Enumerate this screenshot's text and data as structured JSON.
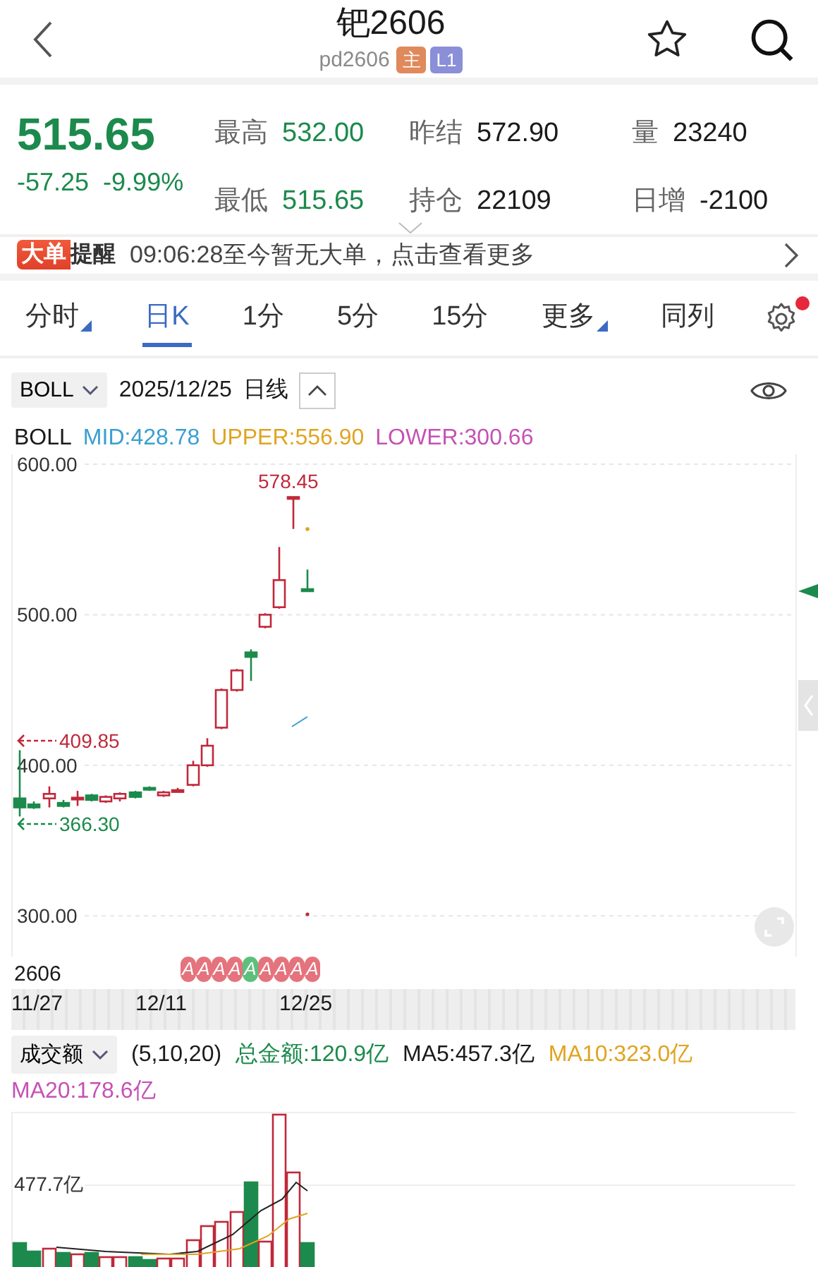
{
  "header": {
    "title": "钯2606",
    "code": "pd2606",
    "tags": [
      {
        "text": "主",
        "color": "#e0895a"
      },
      {
        "text": "L1",
        "color": "#8b8fd8"
      }
    ]
  },
  "quote": {
    "price": "515.65",
    "change": "-57.25",
    "percent": "-9.99%",
    "stats": [
      {
        "label": "最高",
        "value": "532.00",
        "color": "#1c8a4c"
      },
      {
        "label": "昨结",
        "value": "572.90",
        "color": "#1a1a1a"
      },
      {
        "label": "量",
        "value": "23240",
        "color": "#1a1a1a"
      },
      {
        "label": "最低",
        "value": "515.65",
        "color": "#1c8a4c"
      },
      {
        "label": "持仓",
        "value": "22109",
        "color": "#1a1a1a"
      },
      {
        "label": "日增",
        "value": "-2100",
        "color": "#1a1a1a"
      }
    ]
  },
  "alert": {
    "badge_left": "大单",
    "badge_right": "提醒",
    "message": "09:06:28至今暂无大单，点击查看更多"
  },
  "tabs": [
    {
      "label": "分时",
      "selected": false,
      "dropdown": true
    },
    {
      "label": "日K",
      "selected": true,
      "dropdown": false
    },
    {
      "label": "1分",
      "selected": false,
      "dropdown": false
    },
    {
      "label": "5分",
      "selected": false,
      "dropdown": false
    },
    {
      "label": "15分",
      "selected": false,
      "dropdown": false
    },
    {
      "label": "更多",
      "selected": false,
      "dropdown": true
    },
    {
      "label": "同列",
      "selected": false,
      "dropdown": false
    }
  ],
  "settings": {
    "badge": true
  },
  "indicator_bar": {
    "indicator": "BOLL",
    "date": "2025/12/25",
    "period": "日线"
  },
  "boll_legend": [
    {
      "text": "BOLL",
      "color": "#1a1a1a"
    },
    {
      "text": "MID:428.78",
      "color": "#3a9fd0"
    },
    {
      "text": "UPPER:556.90",
      "color": "#e0a422"
    },
    {
      "text": "LOWER:300.66",
      "color": "#c552b4"
    }
  ],
  "price_chart": {
    "y_labels": [
      "600.00",
      "500.00",
      "400.00",
      "300.00"
    ],
    "high_label": "578.45",
    "max_marker": "409.85",
    "min_marker": "366.30"
  },
  "signals": {
    "contract": "2606",
    "bubbles": [
      {
        "text": "A",
        "color": "#e5737d"
      },
      {
        "text": "A",
        "color": "#e5737d"
      },
      {
        "text": "A",
        "color": "#e5737d"
      },
      {
        "text": "A",
        "color": "#e5737d"
      },
      {
        "text": "A",
        "color": "#5cc07a"
      },
      {
        "text": "A",
        "color": "#e5737d"
      },
      {
        "text": "A",
        "color": "#e5737d"
      },
      {
        "text": "A",
        "color": "#e5737d"
      },
      {
        "text": "A",
        "color": "#e5737d"
      }
    ]
  },
  "dates": [
    "11/27",
    "12/11",
    "12/25"
  ],
  "volume": {
    "indicator": "成交额",
    "legend": [
      {
        "text": "(5,10,20)",
        "color": "#1a1a1a"
      },
      {
        "text": "总金额:120.9亿",
        "color": "#1c8a4c"
      },
      {
        "text": "MA5:457.3亿",
        "color": "#1a1a1a"
      },
      {
        "text": "MA10:323.0亿",
        "color": "#e0a422"
      },
      {
        "text": "MA20:178.6亿",
        "color": "#c552b4"
      }
    ],
    "y_label": "477.7亿"
  }
}
